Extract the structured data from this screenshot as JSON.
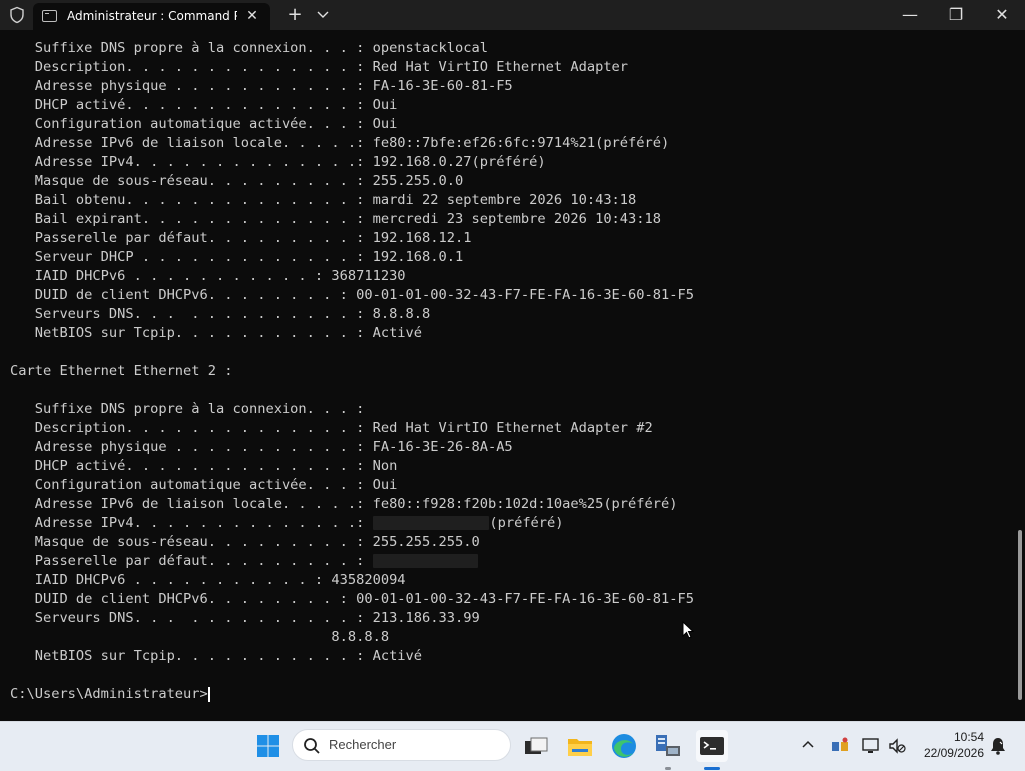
{
  "window": {
    "tab_title": "Administrateur : Command Pr",
    "new_tab_label": "+",
    "tab_menu_label": "⌄",
    "min_label": "—",
    "max_label": "❐",
    "close_label": "✕",
    "tab_close_label": "✕"
  },
  "terminal": {
    "lines": [
      "   Suffixe DNS propre à la connexion. . . : openstacklocal",
      "   Description. . . . . . . . . . . . . . : Red Hat VirtIO Ethernet Adapter",
      "   Adresse physique . . . . . . . . . . . : FA-16-3E-60-81-F5",
      "   DHCP activé. . . . . . . . . . . . . . : Oui",
      "   Configuration automatique activée. . . : Oui",
      "   Adresse IPv6 de liaison locale. . . . .: fe80::7bfe:ef26:6fc:9714%21(préféré)",
      "   Adresse IPv4. . . . . . . . . . . . . .: 192.168.0.27(préféré)",
      "   Masque de sous-réseau. . . . . . . . . : 255.255.0.0",
      "   Bail obtenu. . . . . . . . . . . . . . : mardi 22 septembre 2026 10:43:18",
      "   Bail expirant. . . . . . . . . . . . . : mercredi 23 septembre 2026 10:43:18",
      "   Passerelle par défaut. . . . . . . . . : 192.168.12.1",
      "   Serveur DHCP . . . . . . . . . . . . . : 192.168.0.1",
      "   IAID DHCPv6 . . . . . . . . . . . : 368711230",
      "   DUID de client DHCPv6. . . . . . . . : 00-01-01-00-32-43-F7-FE-FA-16-3E-60-81-F5",
      "   Serveurs DNS. . .  . . . . . . . . . . : 8.8.8.8",
      "   NetBIOS sur Tcpip. . . . . . . . . . . : Activé",
      "",
      "Carte Ethernet Ethernet 2 :",
      "",
      "   Suffixe DNS propre à la connexion. . . :",
      "   Description. . . . . . . . . . . . . . : Red Hat VirtIO Ethernet Adapter #2",
      "   Adresse physique . . . . . . . . . . . : FA-16-3E-26-8A-A5",
      "   DHCP activé. . . . . . . . . . . . . . : Non",
      "   Configuration automatique activée. . . : Oui",
      "   Adresse IPv6 de liaison locale. . . . .: fe80::f928:f20b:102d:10ae%25(préféré)",
      "   Adresse IPv4. . . . . . . . . . . . . .:",
      "   Masque de sous-réseau. . . . . . . . . : 255.255.255.0",
      "   Passerelle par défaut. . . . . . . . . :",
      "   IAID DHCPv6 . . . . . . . . . . . : 435820094",
      "   DUID de client DHCPv6. . . . . . . . : 00-01-01-00-32-43-F7-FE-FA-16-3E-60-81-F5",
      "   Serveurs DNS. . .  . . . . . . . . . . : 213.186.33.99",
      "                                       8.8.8.8",
      "   NetBIOS sur Tcpip. . . . . . . . . . . : Activé",
      "",
      "C:\\Users\\Administrateur>"
    ],
    "ipv4_suffix": "(préféré)"
  },
  "taskbar": {
    "search_placeholder": "Rechercher",
    "time": "10:54",
    "date": "22/09/2026",
    "apps": [
      "start-icon",
      "task-view-icon",
      "file-explorer-icon",
      "edge-icon",
      "server-manager-icon",
      "terminal-icon"
    ]
  },
  "colors": {
    "terminal_bg": "#0c0c0c",
    "terminal_fg": "#cccccc",
    "taskbar_bg": "#e7ecf3",
    "accent": "#1a6fd1"
  }
}
